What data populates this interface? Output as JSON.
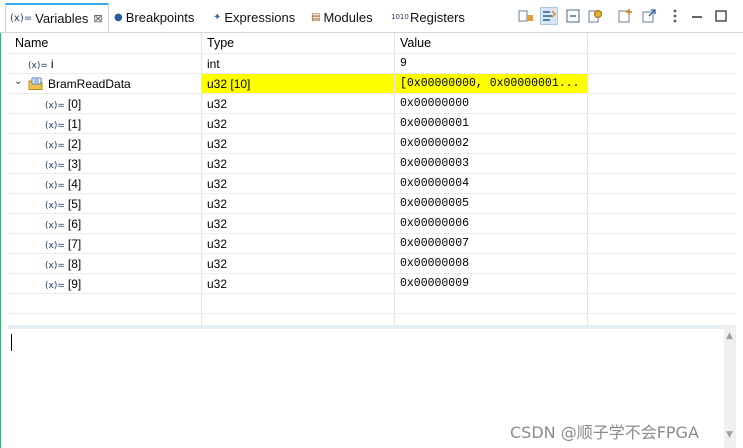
{
  "tabs": [
    {
      "icon": "(x)=",
      "label": "Variables",
      "active": true
    },
    {
      "icon": "●",
      "label": "Breakpoints"
    },
    {
      "icon": "✦",
      "label": "Expressions"
    },
    {
      "icon": "▤",
      "label": "Modules"
    },
    {
      "icon": "1010",
      "label": "Registers"
    }
  ],
  "tab_close": "⊠",
  "toolbar": {
    "icons": [
      "show-type-names-icon",
      "show-logical-structure-icon",
      "collapse-all-icon",
      "pin-icon",
      "add-expression-icon",
      "new-view-icon",
      "view-menu-icon",
      "minimize-icon",
      "maximize-icon"
    ]
  },
  "columns": {
    "name": "Name",
    "type": "Type",
    "value": "Value"
  },
  "variables": {
    "top": {
      "icon": "(x)=",
      "name": "i",
      "type": "int",
      "value": "9"
    },
    "array": {
      "twisty": "⌄",
      "name": "BramReadData",
      "type": "u32 [10]",
      "value": "[0x00000000, 0x00000001..."
    },
    "elements": [
      {
        "icon": "(x)=",
        "name": "[0]",
        "type": "u32",
        "value": "0x00000000"
      },
      {
        "icon": "(x)=",
        "name": "[1]",
        "type": "u32",
        "value": "0x00000001"
      },
      {
        "icon": "(x)=",
        "name": "[2]",
        "type": "u32",
        "value": "0x00000002"
      },
      {
        "icon": "(x)=",
        "name": "[3]",
        "type": "u32",
        "value": "0x00000003"
      },
      {
        "icon": "(x)=",
        "name": "[4]",
        "type": "u32",
        "value": "0x00000004"
      },
      {
        "icon": "(x)=",
        "name": "[5]",
        "type": "u32",
        "value": "0x00000005"
      },
      {
        "icon": "(x)=",
        "name": "[6]",
        "type": "u32",
        "value": "0x00000006"
      },
      {
        "icon": "(x)=",
        "name": "[7]",
        "type": "u32",
        "value": "0x00000007"
      },
      {
        "icon": "(x)=",
        "name": "[8]",
        "type": "u32",
        "value": "0x00000008"
      },
      {
        "icon": "(x)=",
        "name": "[9]",
        "type": "u32",
        "value": "0x00000009"
      }
    ]
  },
  "scroll": {
    "up": "▲",
    "down": "▼"
  },
  "watermark": "CSDN @顺子学不会FPGA",
  "colors": {
    "highlight": "#ffff00",
    "active_tab_border": "#39a8ec",
    "accent_line": "#3cb371"
  }
}
